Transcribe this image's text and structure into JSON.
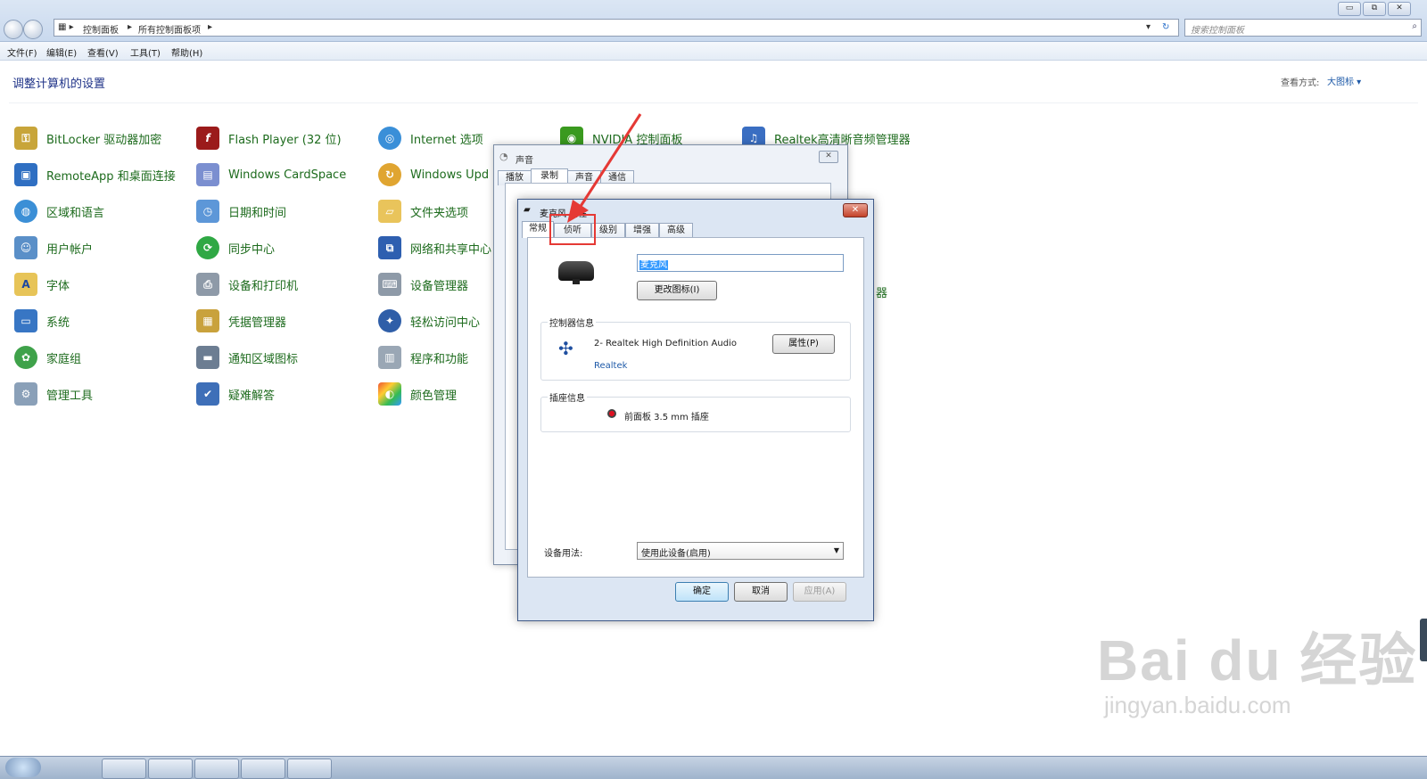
{
  "explorer": {
    "breadcrumb": [
      "控制面板",
      "所有控制面板项"
    ],
    "search_placeholder": "搜索控制面板",
    "window_buttons": [
      "▭",
      "⧉",
      "✕"
    ],
    "menu": [
      "文件(F)",
      "编辑(E)",
      "查看(V)",
      "工具(T)",
      "帮助(H)"
    ],
    "page_title": "调整计算机的设置",
    "view_label": "查看方式:",
    "view_value": "大图标 ▾"
  },
  "control_panel_items": {
    "col1": [
      "BitLocker 驱动器加密",
      "RemoteApp 和桌面连接",
      "区域和语言",
      "用户帐户",
      "字体",
      "系统",
      "家庭组",
      "管理工具"
    ],
    "col2": [
      "Flash Player (32 位)",
      "Windows CardSpace",
      "日期和时间",
      "同步中心",
      "设备和打印机",
      "凭据管理器",
      "通知区域图标",
      "疑难解答"
    ],
    "col3": [
      "Internet 选项",
      "Windows Upd",
      "文件夹选项",
      "网络和共享中心",
      "设备管理器",
      "轻松访问中心",
      "程序和功能",
      "颜色管理"
    ],
    "col4_top": "NVIDIA 控制面板",
    "col5_top": "Realtek高清晰音频管理器",
    "right_fragment": "器"
  },
  "sound_dialog": {
    "title": "声音",
    "tabs": [
      "播放",
      "录制",
      "声音",
      "通信"
    ]
  },
  "mic_dialog": {
    "title": "麦克风 属性",
    "tabs": [
      "常规",
      "侦听",
      "级别",
      "增强",
      "高级"
    ],
    "device_name": "麦克风",
    "change_icon_button": "更改图标(I)",
    "controller_group": "控制器信息",
    "controller_name": "2- Realtek High Definition Audio",
    "controller_vendor": "Realtek",
    "properties_button": "属性(P)",
    "jack_group": "插座信息",
    "jack_info": "前面板 3.5 mm 插座",
    "usage_label": "设备用法:",
    "usage_value": "使用此设备(启用)",
    "ok_button": "确定",
    "cancel_button": "取消",
    "apply_button": "应用(A)"
  },
  "watermark": {
    "brand": "Bai du 经验",
    "url": "jingyan.baidu.com"
  },
  "colors": {
    "item_text": "#1d6b1d",
    "highlight": "#e53935",
    "link": "#1e3287"
  }
}
